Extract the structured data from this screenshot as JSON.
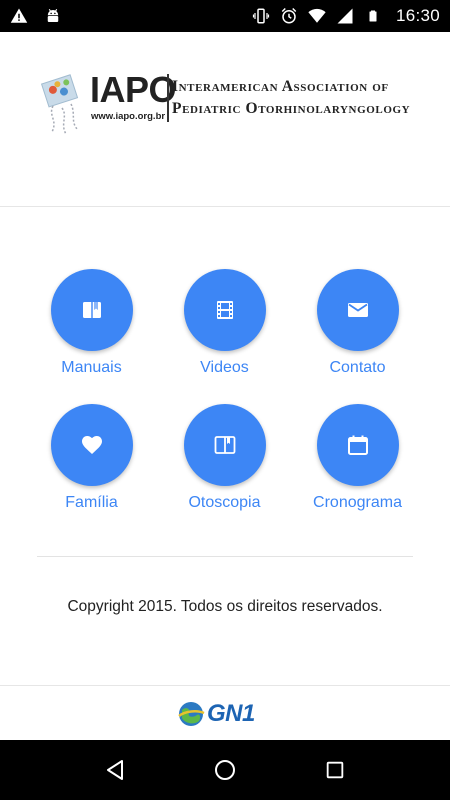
{
  "status_bar": {
    "time": "16:30",
    "left_icons": [
      "warning-icon",
      "android-icon"
    ],
    "right_icons": [
      "vibrate-icon",
      "alarm-icon",
      "wifi-icon",
      "signal-icon",
      "battery-icon"
    ]
  },
  "header": {
    "logo_acronym": "IAPO",
    "logo_url": "www.iapo.org.br",
    "logo_name_line1": "Interamerican Association of",
    "logo_name_line2": "Pediatric Otorhinolaryngology"
  },
  "menu": {
    "accent_color": "#3d86f5",
    "items": [
      {
        "label": "Manuais",
        "icon": "book-icon"
      },
      {
        "label": "Videos",
        "icon": "film-icon"
      },
      {
        "label": "Contato",
        "icon": "mail-icon"
      },
      {
        "label": "Família",
        "icon": "heart-icon"
      },
      {
        "label": "Otoscopia",
        "icon": "open-book-icon"
      },
      {
        "label": "Cronograma",
        "icon": "calendar-icon"
      }
    ]
  },
  "copyright": "Copyright 2015. Todos os direitos reservados.",
  "footer": {
    "brand": "GN1"
  },
  "nav_bar": {
    "buttons": [
      "back-icon",
      "home-icon",
      "recents-icon"
    ]
  }
}
